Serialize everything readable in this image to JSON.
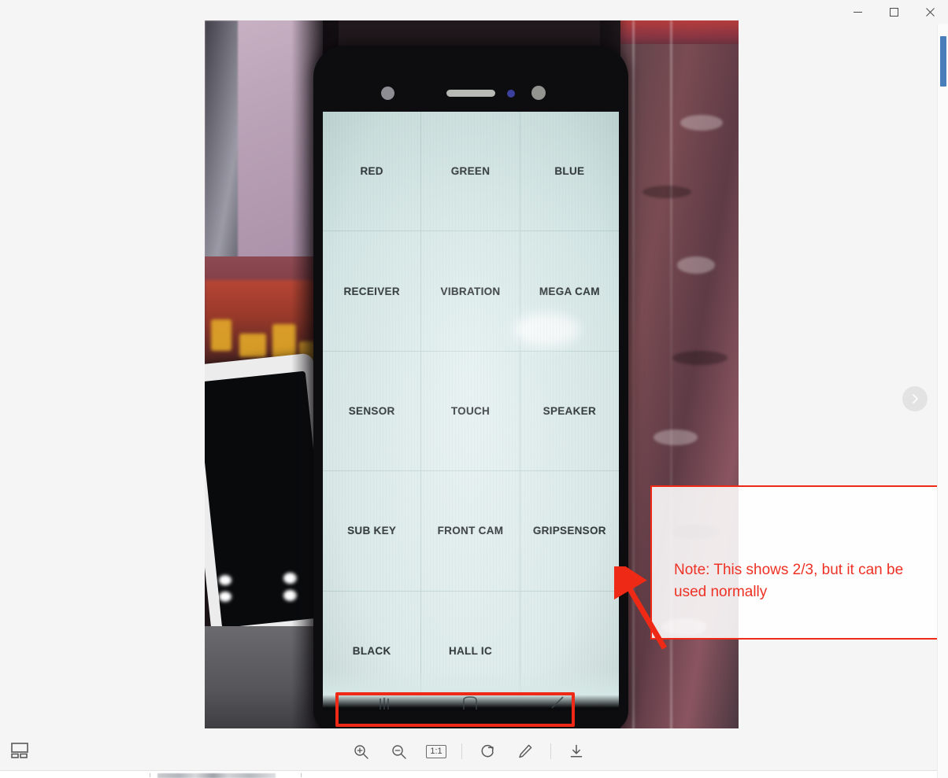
{
  "window": {
    "controls": [
      {
        "name": "minimize",
        "glyph": "minimize-icon"
      },
      {
        "name": "maximize",
        "glyph": "maximize-icon"
      },
      {
        "name": "close",
        "glyph": "close-icon"
      }
    ]
  },
  "viewer": {
    "next_button_label": "next-image",
    "filmstrip_toggle_label": "thumbnail-view"
  },
  "toolbar": {
    "zoom_in_label": "Zoom in",
    "zoom_out_label": "Zoom out",
    "actual_size_label": "1:1",
    "rotate_label": "Rotate",
    "edit_label": "Edit",
    "download_label": "Download"
  },
  "photo": {
    "device_test_screen": {
      "rows": [
        [
          "RED",
          "GREEN",
          "BLUE"
        ],
        [
          "RECEIVER",
          "VIBRATION",
          "MEGA CAM"
        ],
        [
          "SENSOR",
          "TOUCH",
          "SPEAKER"
        ],
        [
          "SUB KEY",
          "FRONT CAM",
          "GRIPSENSOR"
        ],
        [
          "BLACK",
          "HALL IC",
          ""
        ]
      ],
      "navbar_glyphs": [
        "|||",
        "□",
        "⟋"
      ]
    },
    "annotations": {
      "note_text": "Note: This shows 2/3, but it can be used normally",
      "note_color": "#ee3124",
      "box_color": "#ee2a16"
    }
  }
}
